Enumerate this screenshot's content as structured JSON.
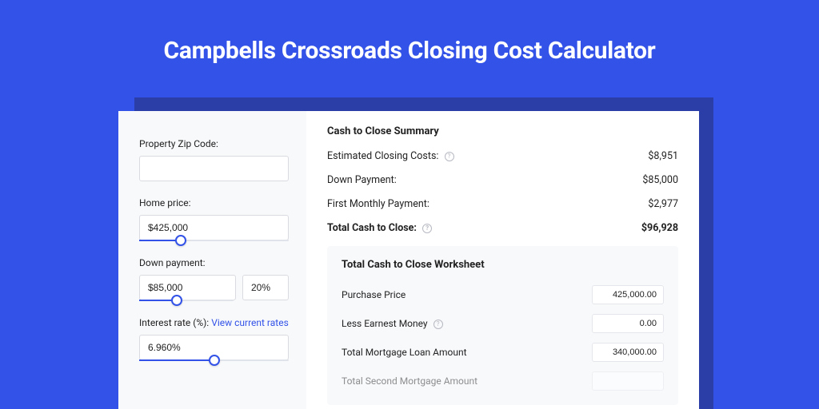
{
  "page": {
    "title": "Campbells Crossroads Closing Cost Calculator"
  },
  "sidebar": {
    "zip_label": "Property Zip Code:",
    "zip_value": "",
    "home_price_label": "Home price:",
    "home_price_value": "$425,000",
    "home_price_slider_pct": 28,
    "down_payment_label": "Down payment:",
    "down_payment_value": "$85,000",
    "down_payment_pct_value": "20%",
    "down_payment_slider_pct": 40,
    "interest_label_prefix": "Interest rate (%): ",
    "interest_link_text": "View current rates",
    "interest_rate_value": "6.960%",
    "interest_slider_pct": 50
  },
  "summary": {
    "title": "Cash to Close Summary",
    "rows": [
      {
        "label": "Estimated Closing Costs:",
        "help": true,
        "value": "$8,951"
      },
      {
        "label": "Down Payment:",
        "help": false,
        "value": "$85,000"
      },
      {
        "label": "First Monthly Payment:",
        "help": false,
        "value": "$2,977"
      }
    ],
    "total_label": "Total Cash to Close:",
    "total_value": "$96,928"
  },
  "worksheet": {
    "title": "Total Cash to Close Worksheet",
    "rows": [
      {
        "label": "Purchase Price",
        "help": false,
        "value": "425,000.00"
      },
      {
        "label": "Less Earnest Money",
        "help": true,
        "value": "0.00"
      },
      {
        "label": "Total Mortgage Loan Amount",
        "help": false,
        "value": "340,000.00"
      },
      {
        "label": "Total Second Mortgage Amount",
        "help": false,
        "value": ""
      }
    ]
  }
}
